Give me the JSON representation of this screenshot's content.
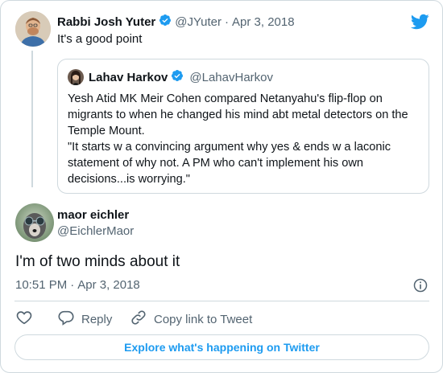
{
  "reply_tweet": {
    "author_name": "Rabbi Josh Yuter",
    "handle": "@JYuter",
    "separator": "·",
    "date": "Apr 3, 2018",
    "text": "It's a good point"
  },
  "quoted_tweet": {
    "author_name": "Lahav Harkov",
    "handle": "@LahavHarkov",
    "paragraph_1": "Yesh Atid MK Meir Cohen compared Netanyahu's flip-flop on migrants to when he changed his mind abt metal detectors on the Temple Mount.",
    "paragraph_2": "\"It starts w a convincing argument why yes & ends w a laconic statement of why not. A PM who can't implement his own decisions...is worrying.\""
  },
  "main_tweet": {
    "author_name": "maor eichler",
    "handle": "@EichlerMaor",
    "text": "I'm of two minds about it",
    "time": "10:51 PM",
    "separator": "·",
    "date": "Apr 3, 2018"
  },
  "actions": {
    "reply_label": "Reply",
    "copy_link_label": "Copy link to Tweet"
  },
  "explore_label": "Explore what's happening on Twitter",
  "colors": {
    "twitter_blue": "#1d9bf0",
    "muted_text": "#536471",
    "border": "#cfd9de"
  },
  "icons": [
    "twitter-logo-icon",
    "verified-badge-icon",
    "info-icon",
    "heart-icon",
    "reply-icon",
    "link-icon"
  ]
}
